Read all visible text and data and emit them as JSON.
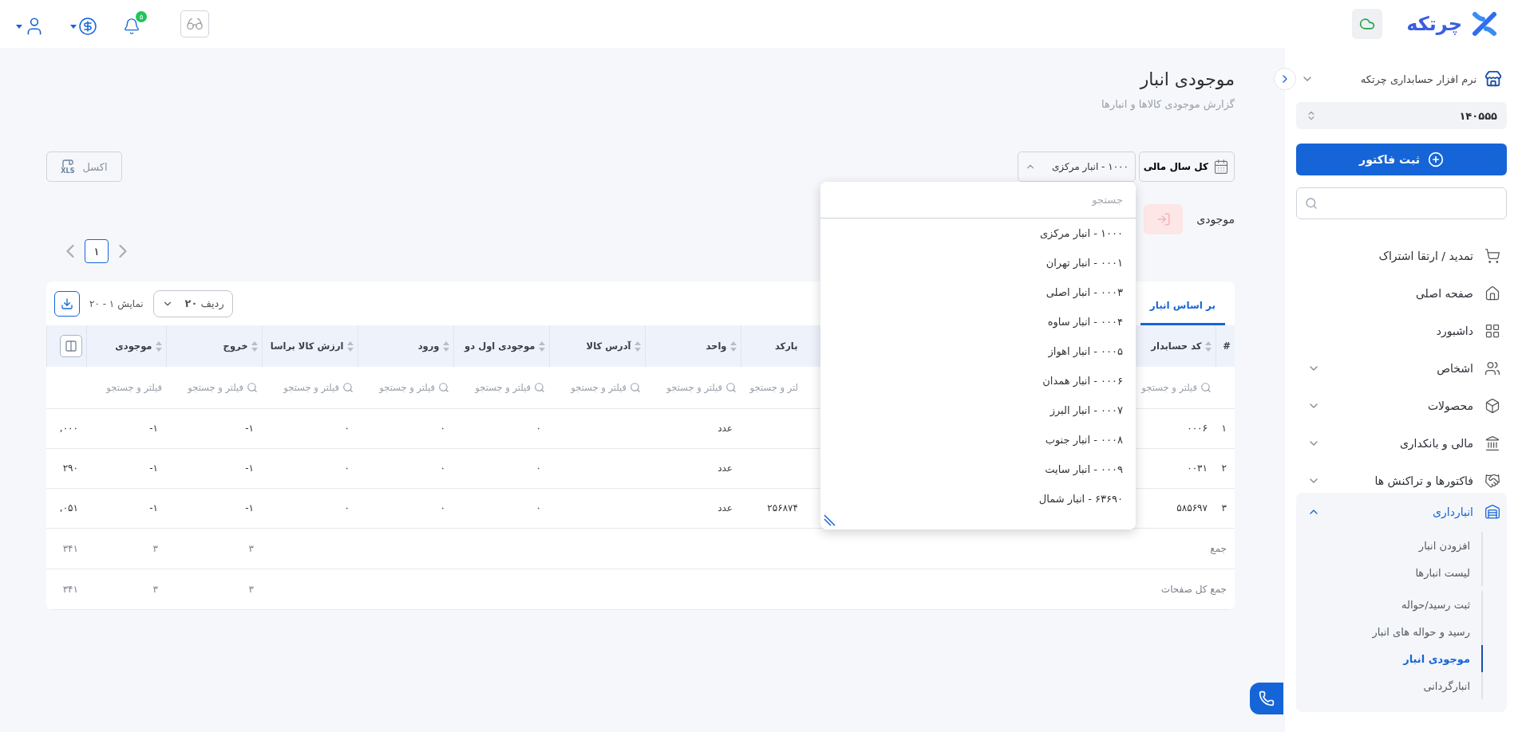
{
  "topbar": {
    "logo": "چرتکه",
    "notification_badge": "۵"
  },
  "sidebar": {
    "company": "نرم افزار حسابداری چرتکه",
    "account": "۱۴۰۵۵۵",
    "primary_button": "ثبت فاکتور",
    "items": [
      {
        "label": "تمدید / ارتقا اشتراک",
        "expandable": false,
        "expanded": false
      },
      {
        "label": "صفحه اصلی",
        "expandable": false,
        "expanded": false
      },
      {
        "label": "داشبورد",
        "expandable": false,
        "expanded": false
      },
      {
        "label": "اشخاص",
        "expandable": true,
        "expanded": false
      },
      {
        "label": "محصولات",
        "expandable": true,
        "expanded": false
      },
      {
        "label": "مالی و بانکداری",
        "expandable": true,
        "expanded": false
      },
      {
        "label": "فاکتورها و تراکنش ها",
        "expandable": true,
        "expanded": false
      },
      {
        "label": "انبارداری",
        "expandable": true,
        "expanded": true,
        "child_groups": [
          {
            "items": [
              {
                "label": "افزودن انبار",
                "selected": false
              },
              {
                "label": "لیست انبارها",
                "selected": false
              }
            ]
          },
          {
            "items": [
              {
                "label": "ثبت رسید/حواله",
                "selected": false
              },
              {
                "label": "رسید و حواله های انبار",
                "selected": false
              },
              {
                "label": "موجودی انبار",
                "selected": true
              },
              {
                "label": "انبارگردانی",
                "selected": false
              }
            ]
          }
        ]
      }
    ]
  },
  "page": {
    "title": "موجودی انبار",
    "subtitle": "گزارش موجودی کالاها و انبارها"
  },
  "filters": {
    "period": "کل سال مالی",
    "warehouse": {
      "value": "۱۰۰۰ - انبار مرکزی",
      "open": true,
      "search_placeholder": "جستجو",
      "options": [
        "۱۰۰۰ - انبار مرکزی",
        "۰۰۰۱ - انبار تهران",
        "۰۰۰۳ - انبار اصلی",
        "۰۰۰۴ - انبار ساوه",
        "۰۰۰۵ - انبار اهواز",
        "۰۰۰۶ - انبار همدان",
        "۰۰۰۷ - انبار البرز",
        "۰۰۰۸ - انبار جنوب",
        "۰۰۰۹ - انبار سایت",
        "۶۳۶۹۰ - انبار شمال"
      ]
    },
    "export": {
      "label": "اکسل",
      "file_type": "XLS"
    }
  },
  "stock_filter": {
    "label": "موجودی"
  },
  "pagination": {
    "pages": [
      {
        "label": "۱",
        "selected": true
      }
    ]
  },
  "table": {
    "tabs": [
      {
        "label": "بر اساس انبار",
        "selected": true
      }
    ],
    "page_size_label": "ردیف",
    "page_size": "۲۰",
    "range": "نمایش ۱ - ۲۰",
    "columns": [
      {
        "label": "#",
        "sortable": false
      },
      {
        "label": "کد حسابدار",
        "sortable": true,
        "filter": {
          "placeholder": "فیلتر و جستجو",
          "icon": true
        }
      },
      {
        "label": "بارکد",
        "sortable": false,
        "filter": {
          "placeholder": "لتر و جستجو",
          "icon": false
        }
      },
      {
        "label": "واحد",
        "sortable": true,
        "filter": {
          "placeholder": "فیلتر و جستجو",
          "icon": true
        }
      },
      {
        "label": "آدرس کالا",
        "sortable": true,
        "filter": {
          "placeholder": "فیلتر و جستجو",
          "icon": true
        }
      },
      {
        "label": "موجودی اول دو",
        "sortable": true,
        "filter": {
          "placeholder": "فیلتر و جستجو",
          "icon": true
        }
      },
      {
        "label": "ورود",
        "sortable": true,
        "filter": {
          "placeholder": "فیلتر و جستجو",
          "icon": true
        }
      },
      {
        "label": "ارزش کالا براسا",
        "sortable": true,
        "filter": {
          "placeholder": "فیلتر و جستجو",
          "icon": true
        }
      },
      {
        "label": "خروج",
        "sortable": true,
        "filter": {
          "placeholder": "فیلتر و جستجو",
          "icon": true
        }
      },
      {
        "label": "موجودی",
        "sortable": true,
        "filter": {
          "placeholder": "فیلتر و جستجو",
          "icon": false
        }
      }
    ],
    "rows": [
      {
        "number": "۱",
        "code": "۰۰۰۶",
        "unit": "عدد",
        "opening_stock": "۰",
        "incoming": "۰",
        "goods_value": "۰",
        "outgoing": "-۱",
        "stock": "-۱",
        "column_11": ",۰۰۰"
      },
      {
        "number": "۲",
        "code": "۰۰۳۱",
        "unit": "عدد",
        "opening_stock": "۰",
        "incoming": "۰",
        "goods_value": "۰",
        "outgoing": "-۱",
        "stock": "-۱",
        "column_11": "۲۹۰"
      },
      {
        "number": "۳",
        "code": "۵۸۵۶۹۷",
        "barcode": "۲۵۶۸۷۴",
        "unit": "عدد",
        "opening_stock": "۰",
        "incoming": "۰",
        "goods_value": "۰",
        "outgoing": "-۱",
        "stock": "-۱",
        "column_11": ",۰۵۱"
      }
    ],
    "totals": [
      {
        "label": "جمع",
        "outgoing": "۳",
        "stock": "۳",
        "column_11": "۳۴۱"
      },
      {
        "label": "جمع کل صفحات",
        "outgoing": "۳",
        "stock": "۳",
        "column_11": "۳۴۱"
      }
    ]
  }
}
